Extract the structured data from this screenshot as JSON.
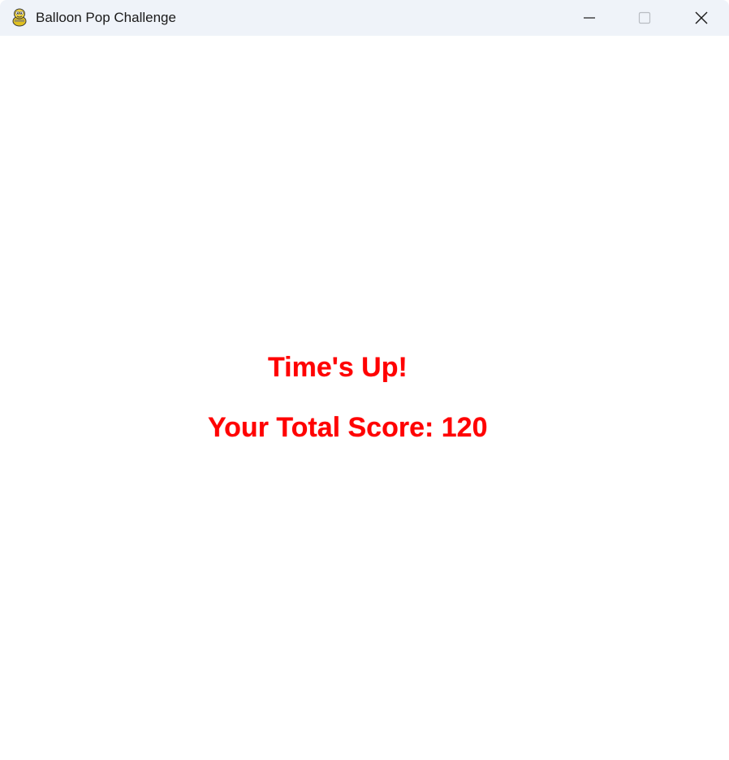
{
  "window": {
    "title": "Balloon Pop Challenge",
    "app_icon": "pygame-snake-icon"
  },
  "controls": {
    "minimize": "minimize-icon",
    "maximize": "maximize-icon",
    "close": "close-icon"
  },
  "game_over": {
    "heading": "Time's Up!",
    "score_text": "Your Total Score: 120",
    "text_color": "#ff0000"
  },
  "colors": {
    "titlebar_bg": "#eff3f9",
    "canvas_bg": "#ffffff"
  }
}
